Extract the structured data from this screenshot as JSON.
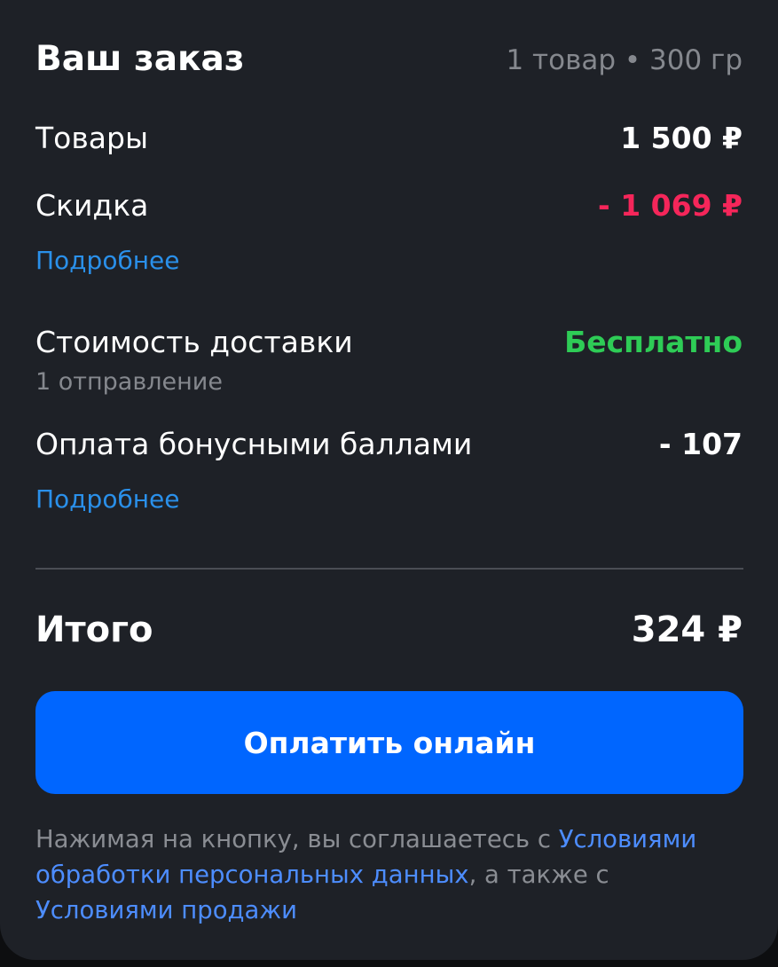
{
  "order": {
    "title": "Ваш заказ",
    "summary": "1 товар • 300 гр"
  },
  "rows": {
    "goods_label": "Товары",
    "goods_value": "1 500 ₽",
    "discount_label": "Скидка",
    "discount_value": "- 1 069 ₽",
    "discount_details": "Подробнее",
    "delivery_label": "Стоимость доставки",
    "delivery_value": "Бесплатно",
    "delivery_note": "1 отправление",
    "bonus_label": "Оплата бонусными баллами",
    "bonus_value": "- 107",
    "bonus_details": "Подробнее"
  },
  "total": {
    "label": "Итого",
    "value": "324 ₽"
  },
  "pay_button": {
    "label": "Оплатить онлайн"
  },
  "legal": {
    "prefix": "Нажимая на кнопку, вы соглашаетесь с ",
    "link_personal": "Условиями обработки персональных данных",
    "middle": ", а также с ",
    "link_sale": "Условиями продажи"
  },
  "colors": {
    "background": "#1e2127",
    "accent": "#0066ff",
    "discount": "#f5265a",
    "free": "#2ecc56",
    "link": "#2a90ea"
  }
}
